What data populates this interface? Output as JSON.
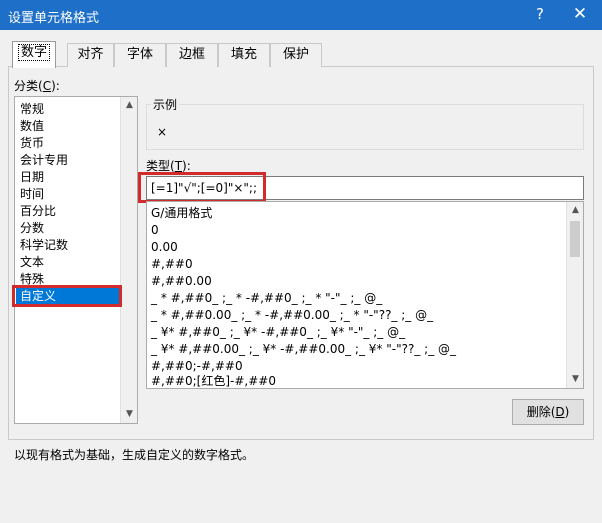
{
  "window": {
    "title": "设置单元格格式",
    "help_glyph": "?",
    "close_glyph": "✕"
  },
  "tabs": [
    {
      "label": "数字",
      "active": true
    },
    {
      "label": "对齐",
      "active": false
    },
    {
      "label": "字体",
      "active": false
    },
    {
      "label": "边框",
      "active": false
    },
    {
      "label": "填充",
      "active": false
    },
    {
      "label": "保护",
      "active": false
    }
  ],
  "category": {
    "label": "分类(",
    "accel": "C",
    "label_end": "):",
    "items": [
      "常规",
      "数值",
      "货币",
      "会计专用",
      "日期",
      "时间",
      "百分比",
      "分数",
      "科学记数",
      "文本",
      "特殊",
      "自定义"
    ],
    "selected": "自定义"
  },
  "sample": {
    "label": "示例",
    "value": "×"
  },
  "type_field": {
    "label": "类型(",
    "accel": "T",
    "label_end": "):",
    "value": "[=1]\"√\";[=0]\"×\";;"
  },
  "formats": [
    "G/通用格式",
    "0",
    "0.00",
    "#,##0",
    "#,##0.00",
    "_ * #,##0_ ;_ * -#,##0_ ;_ * \"-\"_ ;_ @_",
    "_ * #,##0.00_ ;_ * -#,##0.00_ ;_ * \"-\"??_ ;_ @_",
    "_ ¥* #,##0_ ;_ ¥* -#,##0_ ;_ ¥* \"-\"_ ;_ @_",
    "_ ¥* #,##0.00_ ;_ ¥* -#,##0.00_ ;_ ¥* \"-\"??_ ;_ @_",
    "#,##0;-#,##0",
    "#,##0;[红色]-#,##0"
  ],
  "delete_button": {
    "label": "删除(",
    "accel": "D",
    "label_end": ")"
  },
  "footer": "以现有格式为基础，生成自定义的数字格式。",
  "scroll_glyphs": {
    "up": "▲",
    "down": "▼"
  },
  "colors": {
    "titlebar": "#1e6fc8",
    "selection": "#0078d7",
    "highlight_box": "#d12b2b"
  }
}
